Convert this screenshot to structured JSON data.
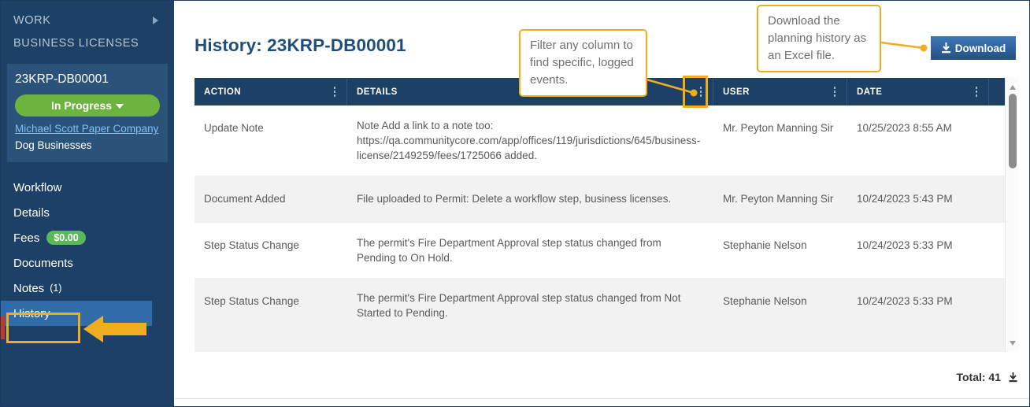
{
  "sidebar": {
    "work_label": "WORK",
    "work_caret_icon": "caret-right-icon",
    "section_label": "BUSINESS LICENSES",
    "license": {
      "id": "23KRP-DB00001",
      "status": "In Progress",
      "status_color": "#6db33f",
      "company_link": "Michael Scott Paper Company",
      "business_type": "Dog Businesses"
    },
    "nav": [
      {
        "label": "Workflow",
        "active": false
      },
      {
        "label": "Details",
        "active": false
      },
      {
        "label": "Fees",
        "pill": "$0.00",
        "active": false
      },
      {
        "label": "Documents",
        "active": false
      },
      {
        "label": "Notes",
        "count": "(1)",
        "active": false
      },
      {
        "label": "History",
        "active": true
      }
    ]
  },
  "main": {
    "page_title": "History: 23KRP-DB00001",
    "download_button": "Download",
    "download_icon": "download-icon"
  },
  "grid": {
    "columns": [
      {
        "label": "ACTION",
        "key": "action"
      },
      {
        "label": "DETAILS",
        "key": "details"
      },
      {
        "label": "USER",
        "key": "user"
      },
      {
        "label": "DATE",
        "key": "date"
      }
    ],
    "column_menu_icon": "kebab-menu-icon",
    "rows": [
      {
        "action": "Update Note",
        "details": "Note Add a link to a note too: https://qa.communitycore.com/app/offices/119/jurisdictions/645/business-license/2149259/fees/1725066 added.",
        "user": "Mr. Peyton Manning Sir",
        "date": "10/25/2023 8:55 AM"
      },
      {
        "action": "Document Added",
        "details": "File uploaded to Permit: Delete a workflow step, business licenses.",
        "user": "Mr. Peyton Manning Sir",
        "date": "10/24/2023 5:43 PM"
      },
      {
        "action": "Step Status Change",
        "details": "The permit's Fire Department Approval step status changed from Pending to On Hold.",
        "user": "Stephanie Nelson",
        "date": "10/24/2023 5:33 PM"
      },
      {
        "action": "Step Status Change",
        "details": "The permit's Fire Department Approval step status changed from Not Started to Pending.",
        "user": "Stephanie Nelson",
        "date": "10/24/2023 5:33 PM"
      }
    ],
    "footer": {
      "total_label": "Total: 41",
      "export_icon": "download-icon"
    },
    "scrollbar": {
      "up_icon": "caret-up-icon",
      "down_icon": "caret-down-icon"
    }
  },
  "annotations": {
    "accent_color": "#f0ad1e",
    "filter_callout": "Filter any column to find specific, logged events.",
    "download_callout": "Download the planning history as an Excel file.",
    "history_arrow_icon": "left-arrow-icon"
  }
}
